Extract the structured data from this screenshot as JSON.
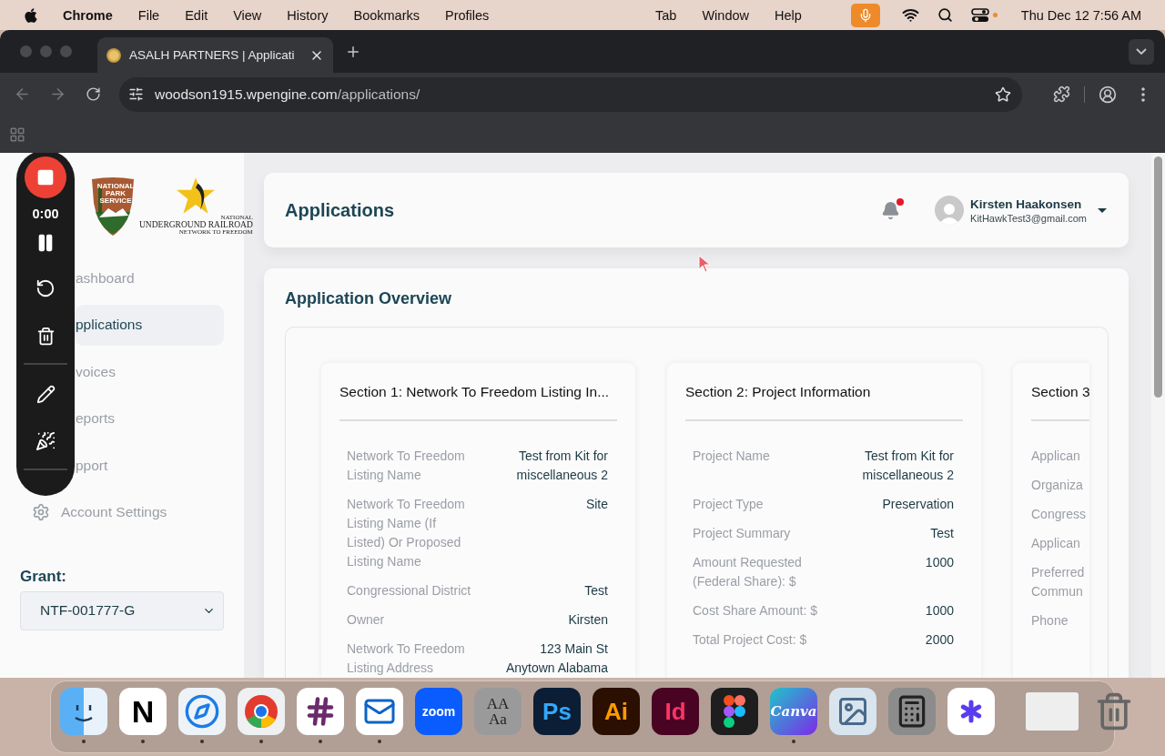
{
  "menu_bar": {
    "app_name": "Chrome",
    "menus": [
      "File",
      "Edit",
      "View",
      "History",
      "Bookmarks",
      "Profiles"
    ],
    "extra_menus": [
      "Tab",
      "Window",
      "Help"
    ],
    "clock": "Thu Dec 12 7:56 AM"
  },
  "browser": {
    "tab_title": "ASALH PARTNERS | Applicati",
    "url_host": "woodson1915.wpengine.com",
    "url_path": "/applications/"
  },
  "recorder": {
    "timer": "0:00"
  },
  "sidebar": {
    "badge_text": [
      "NATIONAL",
      "PARK",
      "SERVICE"
    ],
    "logo_text": [
      "NATIONAL",
      "UNDERGROUND RAILROAD",
      "NETWORK TO FREEDOM"
    ],
    "nav": [
      {
        "label": "ashboard",
        "kind": "covered",
        "selected": false
      },
      {
        "label": "pplications",
        "kind": "covered",
        "selected": true
      },
      {
        "label": "voices",
        "kind": "covered",
        "selected": false
      },
      {
        "label": "eports",
        "kind": "covered",
        "selected": false
      },
      {
        "label": "pport",
        "kind": "covered",
        "selected": false
      },
      {
        "label": "Account Settings",
        "kind": "settings",
        "selected": false
      }
    ],
    "grant_label": "Grant:",
    "grant_value": "NTF-001777-G"
  },
  "header": {
    "title": "Applications",
    "unread": true,
    "user_name": "Kirsten Haakonsen",
    "user_email": "KitHawkTest3@gmail.com"
  },
  "overview": {
    "title": "Application Overview",
    "sections": [
      {
        "kind": "full",
        "title": "Section 1: Network To Freedom Listing In...",
        "rows": [
          {
            "label": "Network To Freedom Listing Name",
            "value": "Test from Kit for miscellaneous 2"
          },
          {
            "label": "Network To Freedom Listing Name (If Listed) Or Proposed Listing Name",
            "value": "Site"
          },
          {
            "label": "Congressional District",
            "value": "Test"
          },
          {
            "label": "Owner",
            "value": "Kirsten"
          },
          {
            "label": "Network To Freedom Listing Address",
            "value": "123 Main St Anytown Alabama"
          }
        ]
      },
      {
        "kind": "full",
        "title": "Section 2: Project Information",
        "rows": [
          {
            "label": "Project Name",
            "value": "Test from Kit for miscellaneous 2"
          },
          {
            "label": "Project Type",
            "value": "Preservation"
          },
          {
            "label": "Project Summary",
            "value": "Test"
          },
          {
            "label": "Amount Requested (Federal Share): $",
            "value": "1000"
          },
          {
            "label": "Cost Share Amount: $",
            "value": "1000"
          },
          {
            "label": "Total Project Cost: $",
            "value": "2000"
          }
        ]
      },
      {
        "kind": "clipped",
        "title": "Section 3",
        "rows": [
          {
            "label": "Applican"
          },
          {
            "label": "Organiza"
          },
          {
            "label": "Congress"
          },
          {
            "label": "Applican"
          },
          {
            "label": "Preferred Commun"
          },
          {
            "label": "Phone"
          }
        ]
      }
    ]
  },
  "dock": [
    {
      "kind": "finder",
      "running": true
    },
    {
      "kind": "text",
      "label": "N",
      "running": true
    },
    {
      "kind": "compass",
      "running": true
    },
    {
      "kind": "tricolor",
      "running": true
    },
    {
      "kind": "hash",
      "running": true
    },
    {
      "kind": "mail",
      "running": true
    },
    {
      "kind": "blue",
      "label": "zoom",
      "running": false
    },
    {
      "kind": "font",
      "label": "AA Aa",
      "running": false
    },
    {
      "kind": "ps",
      "label": "Ps",
      "running": false
    },
    {
      "kind": "ai",
      "label": "Ai",
      "running": false
    },
    {
      "kind": "id",
      "label": "Id",
      "running": false
    },
    {
      "kind": "shapes",
      "running": false
    },
    {
      "kind": "canva",
      "label": "Canva",
      "running": true
    },
    {
      "kind": "picture",
      "running": false
    },
    {
      "kind": "calculator",
      "running": false
    },
    {
      "kind": "asterisk",
      "running": false
    }
  ]
}
